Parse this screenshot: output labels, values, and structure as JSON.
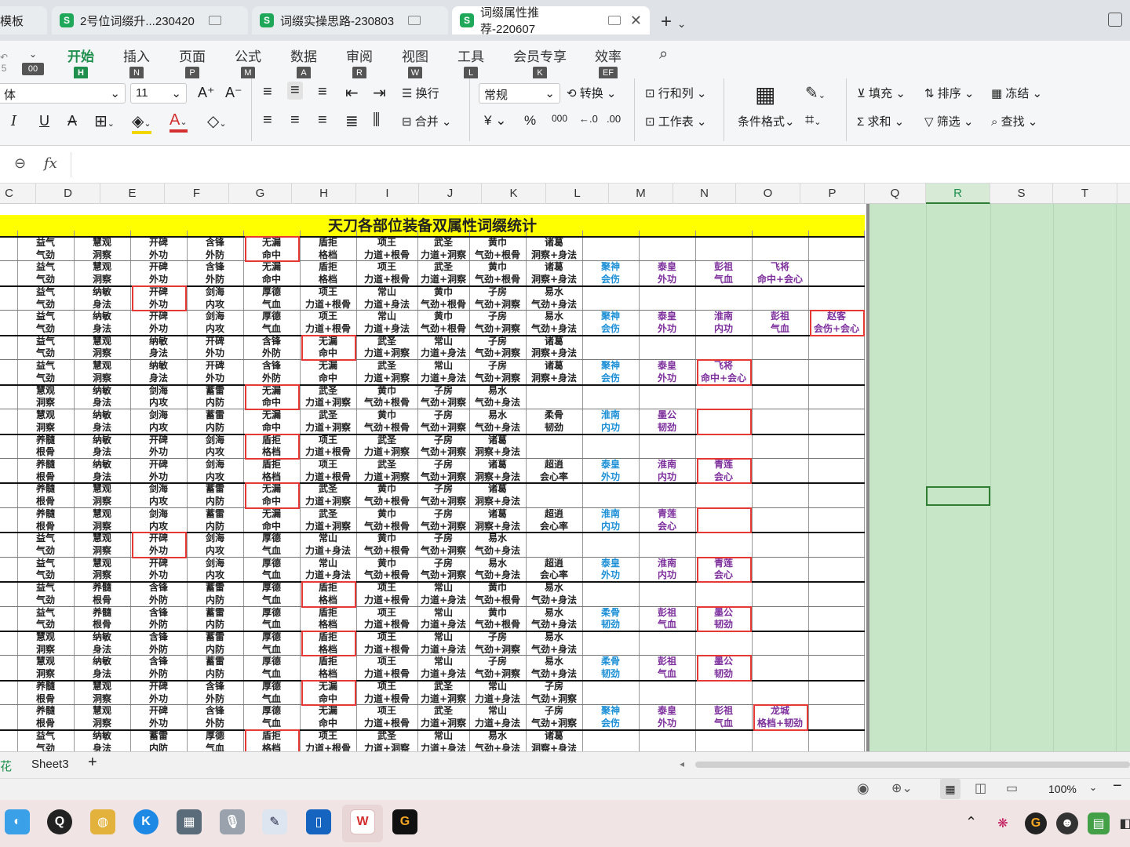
{
  "tabs": [
    {
      "title": "模板",
      "active": false
    },
    {
      "title": "2号位词缀升...230420",
      "active": false
    },
    {
      "title": "词缀实操思路-230803",
      "active": false
    },
    {
      "title": "词缀属性推荐-220607",
      "active": true
    }
  ],
  "ribbon_tabs": [
    {
      "label": "开始",
      "key": "H",
      "active": true
    },
    {
      "label": "插入",
      "key": "N"
    },
    {
      "label": "页面",
      "key": "P"
    },
    {
      "label": "公式",
      "key": "M"
    },
    {
      "label": "数据",
      "key": "A"
    },
    {
      "label": "审阅",
      "key": "R"
    },
    {
      "label": "视图",
      "key": "W"
    },
    {
      "label": "工具",
      "key": "L"
    },
    {
      "label": "会员专享",
      "key": "K"
    },
    {
      "label": "效率",
      "key": "EF"
    }
  ],
  "ribbon_left_key": "00",
  "ribbon_left_num": "5",
  "font": {
    "name": "体",
    "size": "11"
  },
  "number_format": "常规",
  "ribbon_buttons": {
    "wrap": "换行",
    "convert": "转换",
    "rows_cols": "行和列",
    "merge": "合并",
    "worksheet": "工作表",
    "cond_format": "条件格式",
    "fill": "填充",
    "sort": "排序",
    "freeze": "冻结",
    "sum": "求和",
    "filter": "筛选",
    "find": "查找",
    "currency": "¥",
    "percent": "%",
    "thousands": "000"
  },
  "formula_bar": {
    "fx": "fx",
    "value": ""
  },
  "columns": [
    "C",
    "D",
    "E",
    "F",
    "G",
    "H",
    "I",
    "J",
    "K",
    "L",
    "M",
    "N",
    "O",
    "P",
    "Q",
    "R",
    "S",
    "T"
  ],
  "sheet_title": "天刀各部位装备双属性词缀统计",
  "rows": [
    [
      "",
      "益气",
      "慧观",
      "开碑",
      "含锋",
      "无漏",
      "盾拒",
      "项王",
      "武圣",
      "黄巾",
      "诸葛",
      "",
      "",
      "",
      "",
      ""
    ],
    [
      "",
      "气劲",
      "洞察",
      "外功",
      "外防",
      "命中",
      "格档",
      "力道+根骨",
      "力道+洞察",
      "气劲+根骨",
      "洞察+身法",
      "",
      "",
      "",
      "",
      ""
    ],
    [
      "",
      "益气",
      "慧观",
      "开碑",
      "含锋",
      "无漏",
      "盾拒",
      "项王",
      "武圣",
      "黄巾",
      "诸葛",
      "聚神",
      "泰皇",
      "彭祖",
      "飞将",
      ""
    ],
    [
      "",
      "气劲",
      "洞察",
      "外功",
      "外防",
      "命中",
      "格档",
      "力道+根骨",
      "力道+洞察",
      "气劲+根骨",
      "洞察+身法",
      "会伤",
      "外功",
      "气血",
      "命中+会心",
      ""
    ],
    [
      "",
      "益气",
      "纳敏",
      "开碑",
      "剑海",
      "厚德",
      "项王",
      "常山",
      "黄巾",
      "子房",
      "易水",
      "",
      "",
      "",
      "",
      ""
    ],
    [
      "",
      "气劲",
      "身法",
      "外功",
      "内攻",
      "气血",
      "力道+根骨",
      "力道+身法",
      "气劲+根骨",
      "气劲+洞察",
      "气劲+身法",
      "",
      "",
      "",
      "",
      ""
    ],
    [
      "",
      "益气",
      "纳敏",
      "开碑",
      "剑海",
      "厚德",
      "项王",
      "常山",
      "黄巾",
      "子房",
      "易水",
      "聚神",
      "泰皇",
      "淮南",
      "彭祖",
      "赵客"
    ],
    [
      "",
      "气劲",
      "身法",
      "外功",
      "内攻",
      "气血",
      "力道+根骨",
      "力道+身法",
      "气劲+根骨",
      "气劲+洞察",
      "气劲+身法",
      "会伤",
      "外功",
      "内功",
      "气血",
      "会伤+会心"
    ],
    [
      "",
      "益气",
      "慧观",
      "纳敏",
      "开碑",
      "含锋",
      "无漏",
      "武圣",
      "常山",
      "子房",
      "诸葛",
      "",
      "",
      "",
      "",
      ""
    ],
    [
      "",
      "气劲",
      "洞察",
      "身法",
      "外功",
      "外防",
      "命中",
      "力道+洞察",
      "力道+身法",
      "气劲+洞察",
      "洞察+身法",
      "",
      "",
      "",
      "",
      ""
    ],
    [
      "",
      "益气",
      "慧观",
      "纳敏",
      "开碑",
      "含锋",
      "无漏",
      "武圣",
      "常山",
      "子房",
      "诸葛",
      "聚神",
      "泰皇",
      "飞将",
      "",
      ""
    ],
    [
      "",
      "气劲",
      "洞察",
      "身法",
      "外功",
      "外防",
      "命中",
      "力道+洞察",
      "力道+身法",
      "气劲+洞察",
      "洞察+身法",
      "会伤",
      "外功",
      "命中+会心",
      "",
      ""
    ],
    [
      "",
      "慧观",
      "纳敏",
      "剑海",
      "蓄雷",
      "无漏",
      "武圣",
      "黄巾",
      "子房",
      "易水",
      "",
      "",
      "",
      "",
      "",
      ""
    ],
    [
      "",
      "洞察",
      "身法",
      "内攻",
      "内防",
      "命中",
      "力道+洞察",
      "气劲+根骨",
      "气劲+洞察",
      "气劲+身法",
      "",
      "",
      "",
      "",
      "",
      ""
    ],
    [
      "",
      "慧观",
      "纳敏",
      "剑海",
      "蓄雷",
      "无漏",
      "武圣",
      "黄巾",
      "子房",
      "易水",
      "柔骨",
      "淮南",
      "墨公",
      "",
      "",
      ""
    ],
    [
      "",
      "洞察",
      "身法",
      "内攻",
      "内防",
      "命中",
      "力道+洞察",
      "气劲+根骨",
      "气劲+洞察",
      "气劲+身法",
      "韧劲",
      "内功",
      "韧劲",
      "",
      "",
      ""
    ],
    [
      "",
      "养髓",
      "纳敏",
      "开碑",
      "剑海",
      "盾拒",
      "项王",
      "武圣",
      "子房",
      "诸葛",
      "",
      "",
      "",
      "",
      "",
      ""
    ],
    [
      "",
      "根骨",
      "身法",
      "外功",
      "内攻",
      "格档",
      "力道+根骨",
      "力道+洞察",
      "气劲+洞察",
      "洞察+身法",
      "",
      "",
      "",
      "",
      "",
      ""
    ],
    [
      "",
      "养髓",
      "纳敏",
      "开碑",
      "剑海",
      "盾拒",
      "项王",
      "武圣",
      "子房",
      "诸葛",
      "超逍",
      "泰皇",
      "淮南",
      "青莲",
      "",
      ""
    ],
    [
      "",
      "根骨",
      "身法",
      "外功",
      "内攻",
      "格档",
      "力道+根骨",
      "力道+洞察",
      "气劲+洞察",
      "洞察+身法",
      "会心率",
      "外功",
      "内功",
      "会心",
      "",
      ""
    ],
    [
      "",
      "养髓",
      "慧观",
      "剑海",
      "蓄雷",
      "无漏",
      "武圣",
      "黄巾",
      "子房",
      "诸葛",
      "",
      "",
      "",
      "",
      "",
      ""
    ],
    [
      "",
      "根骨",
      "洞察",
      "内攻",
      "内防",
      "命中",
      "力道+洞察",
      "气劲+根骨",
      "气劲+洞察",
      "洞察+身法",
      "",
      "",
      "",
      "",
      "",
      ""
    ],
    [
      "",
      "养髓",
      "慧观",
      "剑海",
      "蓄雷",
      "无漏",
      "武圣",
      "黄巾",
      "子房",
      "诸葛",
      "超逍",
      "淮南",
      "青莲",
      "",
      "",
      ""
    ],
    [
      "",
      "根骨",
      "洞察",
      "内攻",
      "内防",
      "命中",
      "力道+洞察",
      "气劲+根骨",
      "气劲+洞察",
      "洞察+身法",
      "会心率",
      "内功",
      "会心",
      "",
      "",
      ""
    ],
    [
      "",
      "益气",
      "慧观",
      "开碑",
      "剑海",
      "厚德",
      "常山",
      "黄巾",
      "子房",
      "易水",
      "",
      "",
      "",
      "",
      "",
      ""
    ],
    [
      "",
      "气劲",
      "洞察",
      "外功",
      "内攻",
      "气血",
      "力道+身法",
      "气劲+根骨",
      "气劲+洞察",
      "气劲+身法",
      "",
      "",
      "",
      "",
      "",
      ""
    ],
    [
      "",
      "益气",
      "慧观",
      "开碑",
      "剑海",
      "厚德",
      "常山",
      "黄巾",
      "子房",
      "易水",
      "超逍",
      "泰皇",
      "淮南",
      "青莲",
      "",
      ""
    ],
    [
      "",
      "气劲",
      "洞察",
      "外功",
      "内攻",
      "气血",
      "力道+身法",
      "气劲+根骨",
      "气劲+洞察",
      "气劲+身法",
      "会心率",
      "外功",
      "内功",
      "会心",
      "",
      ""
    ],
    [
      "",
      "益气",
      "养髓",
      "含锋",
      "蓄雷",
      "厚德",
      "盾拒",
      "项王",
      "常山",
      "黄巾",
      "易水",
      "",
      "",
      "",
      "",
      ""
    ],
    [
      "",
      "气劲",
      "根骨",
      "外防",
      "内防",
      "气血",
      "格档",
      "力道+根骨",
      "力道+身法",
      "气劲+根骨",
      "气劲+身法",
      "",
      "",
      "",
      "",
      ""
    ],
    [
      "",
      "益气",
      "养髓",
      "含锋",
      "蓄雷",
      "厚德",
      "盾拒",
      "项王",
      "常山",
      "黄巾",
      "易水",
      "柔骨",
      "彭祖",
      "墨公",
      "",
      ""
    ],
    [
      "",
      "气劲",
      "根骨",
      "外防",
      "内防",
      "气血",
      "格档",
      "力道+根骨",
      "力道+身法",
      "气劲+根骨",
      "气劲+身法",
      "韧劲",
      "气血",
      "韧劲",
      "",
      ""
    ],
    [
      "",
      "慧观",
      "纳敏",
      "含锋",
      "蓄雷",
      "厚德",
      "盾拒",
      "项王",
      "常山",
      "子房",
      "易水",
      "",
      "",
      "",
      "",
      ""
    ],
    [
      "",
      "洞察",
      "身法",
      "外防",
      "内防",
      "气血",
      "格档",
      "力道+根骨",
      "力道+身法",
      "气劲+洞察",
      "气劲+身法",
      "",
      "",
      "",
      "",
      ""
    ],
    [
      "",
      "慧观",
      "纳敏",
      "含锋",
      "蓄雷",
      "厚德",
      "盾拒",
      "项王",
      "常山",
      "子房",
      "易水",
      "柔骨",
      "彭祖",
      "墨公",
      "",
      ""
    ],
    [
      "",
      "洞察",
      "身法",
      "外防",
      "内防",
      "气血",
      "格档",
      "力道+根骨",
      "力道+身法",
      "气劲+洞察",
      "气劲+身法",
      "韧劲",
      "气血",
      "韧劲",
      "",
      ""
    ],
    [
      "",
      "养髓",
      "慧观",
      "开碑",
      "含锋",
      "厚德",
      "无漏",
      "项王",
      "武圣",
      "常山",
      "子房",
      "",
      "",
      "",
      "",
      ""
    ],
    [
      "",
      "根骨",
      "洞察",
      "外功",
      "外防",
      "气血",
      "命中",
      "力道+根骨",
      "力道+洞察",
      "力道+身法",
      "气劲+洞察",
      "",
      "",
      "",
      "",
      ""
    ],
    [
      "",
      "养髓",
      "慧观",
      "开碑",
      "含锋",
      "厚德",
      "无漏",
      "项王",
      "武圣",
      "常山",
      "子房",
      "聚神",
      "泰皇",
      "彭祖",
      "龙城",
      ""
    ],
    [
      "",
      "根骨",
      "洞察",
      "外功",
      "外防",
      "气血",
      "命中",
      "力道+根骨",
      "力道+洞察",
      "力道+身法",
      "气劲+洞察",
      "会伤",
      "外功",
      "气血",
      "格档+韧劲",
      ""
    ],
    [
      "",
      "益气",
      "纳敏",
      "蓄雷",
      "厚德",
      "盾拒",
      "项王",
      "武圣",
      "常山",
      "易水",
      "诸葛",
      "",
      "",
      "",
      "",
      ""
    ],
    [
      "",
      "气劲",
      "身法",
      "内防",
      "气血",
      "格档",
      "力道+根骨",
      "力道+洞察",
      "力道+身法",
      "气劲+身法",
      "洞察+身法",
      "",
      "",
      "",
      "",
      ""
    ]
  ],
  "sheets": [
    "花",
    "Sheet3"
  ],
  "zoom": "100%"
}
